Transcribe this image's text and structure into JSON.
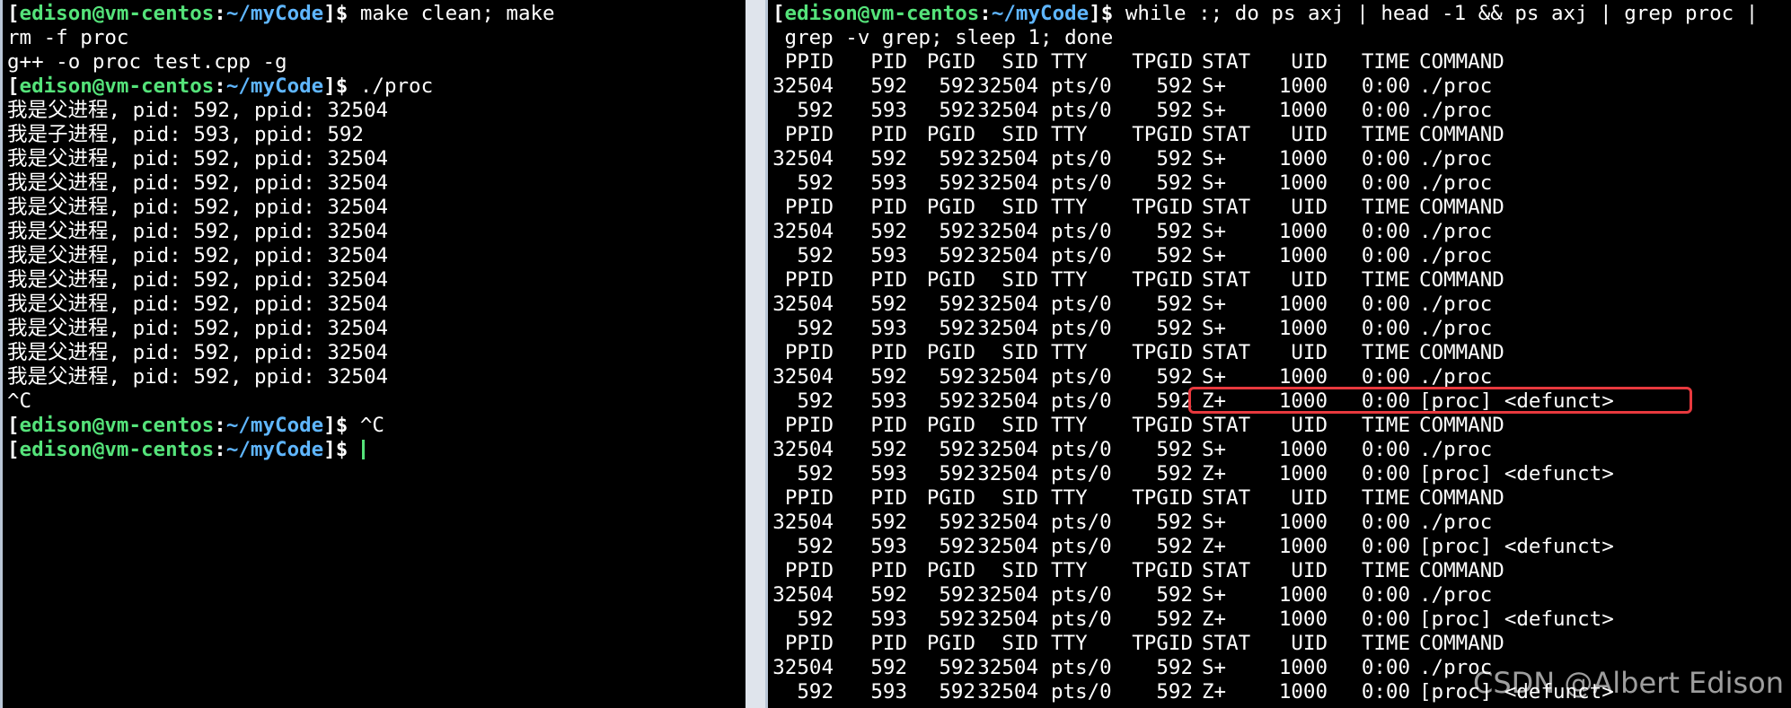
{
  "prompt": {
    "user": "edison@vm-centos",
    "path": "~/myCode"
  },
  "left_terminal": {
    "lines": [
      {
        "type": "prompt",
        "command": " make clean; make"
      },
      {
        "type": "output",
        "text": "rm -f proc"
      },
      {
        "type": "output",
        "text": "g++ -o proc test.cpp -g"
      },
      {
        "type": "prompt",
        "command": " ./proc"
      },
      {
        "type": "output",
        "text": "我是父进程, pid: 592, ppid: 32504"
      },
      {
        "type": "output",
        "text": "我是子进程, pid: 593, ppid: 592"
      },
      {
        "type": "output",
        "text": "我是父进程, pid: 592, ppid: 32504"
      },
      {
        "type": "output",
        "text": "我是父进程, pid: 592, ppid: 32504"
      },
      {
        "type": "output",
        "text": "我是父进程, pid: 592, ppid: 32504"
      },
      {
        "type": "output",
        "text": "我是父进程, pid: 592, ppid: 32504"
      },
      {
        "type": "output",
        "text": "我是父进程, pid: 592, ppid: 32504"
      },
      {
        "type": "output",
        "text": "我是父进程, pid: 592, ppid: 32504"
      },
      {
        "type": "output",
        "text": "我是父进程, pid: 592, ppid: 32504"
      },
      {
        "type": "output",
        "text": "我是父进程, pid: 592, ppid: 32504"
      },
      {
        "type": "output",
        "text": "我是父进程, pid: 592, ppid: 32504"
      },
      {
        "type": "output",
        "text": "我是父进程, pid: 592, ppid: 32504"
      },
      {
        "type": "output",
        "text": "^C"
      },
      {
        "type": "prompt",
        "command": " ^C"
      },
      {
        "type": "prompt",
        "command": " ",
        "cursor": true
      }
    ]
  },
  "right_terminal": {
    "command_line_1": " while :; do ps axj | head -1 && ps axj | grep proc |",
    "command_line_2": " grep -v grep; sleep 1; done",
    "header": [
      "PPID",
      "PID",
      "PGID",
      "SID",
      "TTY",
      "TPGID",
      "STAT",
      "UID",
      "TIME",
      "COMMAND"
    ],
    "rows": [
      {
        "kind": "header"
      },
      {
        "kind": "row",
        "cells": [
          "32504",
          "592",
          "592",
          "32504",
          "pts/0",
          "592",
          "S+",
          "1000",
          "0:00",
          "./proc"
        ]
      },
      {
        "kind": "row",
        "cells": [
          "592",
          "593",
          "592",
          "32504",
          "pts/0",
          "592",
          "S+",
          "1000",
          "0:00",
          "./proc"
        ]
      },
      {
        "kind": "header"
      },
      {
        "kind": "row",
        "cells": [
          "32504",
          "592",
          "592",
          "32504",
          "pts/0",
          "592",
          "S+",
          "1000",
          "0:00",
          "./proc"
        ]
      },
      {
        "kind": "row",
        "cells": [
          "592",
          "593",
          "592",
          "32504",
          "pts/0",
          "592",
          "S+",
          "1000",
          "0:00",
          "./proc"
        ]
      },
      {
        "kind": "header"
      },
      {
        "kind": "row",
        "cells": [
          "32504",
          "592",
          "592",
          "32504",
          "pts/0",
          "592",
          "S+",
          "1000",
          "0:00",
          "./proc"
        ]
      },
      {
        "kind": "row",
        "cells": [
          "592",
          "593",
          "592",
          "32504",
          "pts/0",
          "592",
          "S+",
          "1000",
          "0:00",
          "./proc"
        ]
      },
      {
        "kind": "header"
      },
      {
        "kind": "row",
        "cells": [
          "32504",
          "592",
          "592",
          "32504",
          "pts/0",
          "592",
          "S+",
          "1000",
          "0:00",
          "./proc"
        ]
      },
      {
        "kind": "row",
        "cells": [
          "592",
          "593",
          "592",
          "32504",
          "pts/0",
          "592",
          "S+",
          "1000",
          "0:00",
          "./proc"
        ]
      },
      {
        "kind": "header"
      },
      {
        "kind": "row",
        "cells": [
          "32504",
          "592",
          "592",
          "32504",
          "pts/0",
          "592",
          "S+",
          "1000",
          "0:00",
          "./proc"
        ]
      },
      {
        "kind": "row",
        "cells": [
          "592",
          "593",
          "592",
          "32504",
          "pts/0",
          "592",
          "Z+",
          "1000",
          "0:00",
          "[proc] <defunct>"
        ]
      },
      {
        "kind": "header"
      },
      {
        "kind": "row",
        "cells": [
          "32504",
          "592",
          "592",
          "32504",
          "pts/0",
          "592",
          "S+",
          "1000",
          "0:00",
          "./proc"
        ]
      },
      {
        "kind": "row",
        "cells": [
          "592",
          "593",
          "592",
          "32504",
          "pts/0",
          "592",
          "Z+",
          "1000",
          "0:00",
          "[proc] <defunct>"
        ]
      },
      {
        "kind": "header"
      },
      {
        "kind": "row",
        "cells": [
          "32504",
          "592",
          "592",
          "32504",
          "pts/0",
          "592",
          "S+",
          "1000",
          "0:00",
          "./proc"
        ]
      },
      {
        "kind": "row",
        "cells": [
          "592",
          "593",
          "592",
          "32504",
          "pts/0",
          "592",
          "Z+",
          "1000",
          "0:00",
          "[proc] <defunct>"
        ]
      },
      {
        "kind": "header"
      },
      {
        "kind": "row",
        "cells": [
          "32504",
          "592",
          "592",
          "32504",
          "pts/0",
          "592",
          "S+",
          "1000",
          "0:00",
          "./proc"
        ]
      },
      {
        "kind": "row",
        "cells": [
          "592",
          "593",
          "592",
          "32504",
          "pts/0",
          "592",
          "Z+",
          "1000",
          "0:00",
          "[proc] <defunct>"
        ]
      },
      {
        "kind": "header"
      },
      {
        "kind": "row",
        "cells": [
          "32504",
          "592",
          "592",
          "32504",
          "pts/0",
          "592",
          "S+",
          "1000",
          "0:00",
          "./proc"
        ]
      },
      {
        "kind": "row",
        "cells": [
          "592",
          "593",
          "592",
          "32504",
          "pts/0",
          "592",
          "Z+",
          "1000",
          "0:00",
          "[proc] <defunct>"
        ]
      }
    ]
  },
  "watermark": "CSDN @Albert Edison",
  "colors": {
    "prompt_user": "#55e37a",
    "prompt_path": "#5fb6ff",
    "highlight": "#e8393e"
  }
}
